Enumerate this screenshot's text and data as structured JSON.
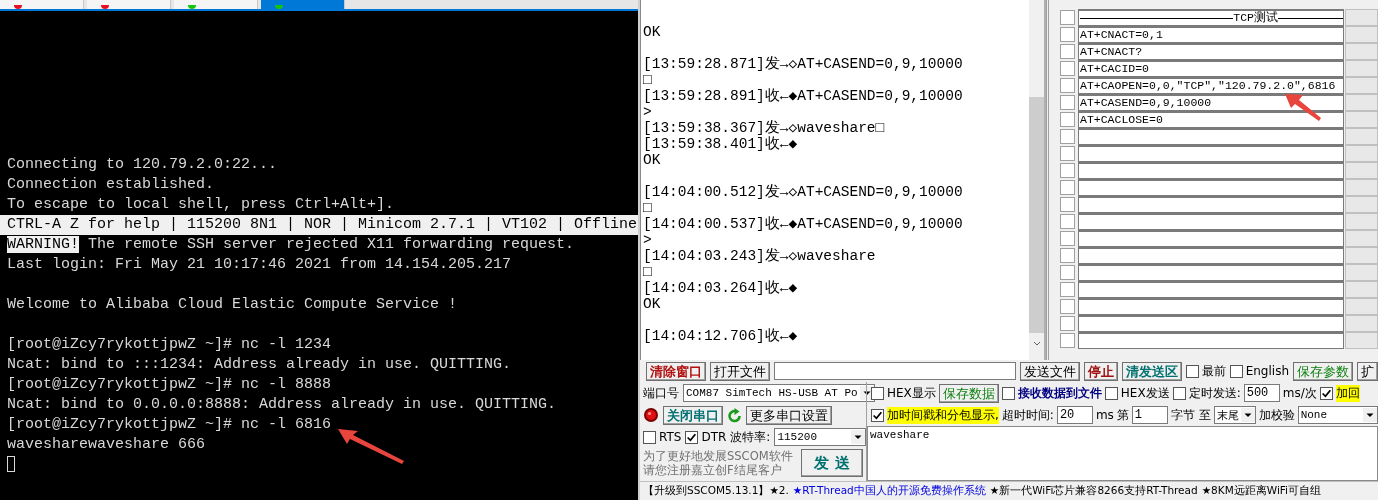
{
  "terminal": {
    "tabs": [
      {
        "color": "#e81123",
        "selected": false
      },
      {
        "color": "#e81123",
        "selected": false
      },
      {
        "color": "#16c60c",
        "selected": false
      },
      {
        "color": "#16c60c",
        "selected": true
      }
    ],
    "lines": [
      {
        "kind": "text",
        "segments": [
          {
            "text": "Connecting to 120.79.2.0:22...",
            "highlighted": false
          }
        ]
      },
      {
        "kind": "text",
        "segments": [
          {
            "text": "Connection established.",
            "highlighted": false
          }
        ]
      },
      {
        "kind": "text",
        "segments": [
          {
            "text": "To escape to local shell, press Ctrl+Alt+].",
            "highlighted": false
          }
        ]
      },
      {
        "kind": "bar",
        "text": "CTRL-A Z for help | 115200 8N1 | NOR | Minicom 2.7.1 | VT102 | Offline"
      },
      {
        "kind": "text",
        "segments": [
          {
            "text": "WARNING!",
            "highlighted": true
          },
          {
            "text": " The remote SSH server rejected X11 forwarding request.",
            "highlighted": false
          }
        ]
      },
      {
        "kind": "text",
        "segments": [
          {
            "text": "Last login: Fri May 21 10:17:46 2021 from 14.154.205.217",
            "highlighted": false
          }
        ]
      },
      {
        "kind": "blank"
      },
      {
        "kind": "text",
        "segments": [
          {
            "text": "Welcome to Alibaba Cloud Elastic Compute Service !",
            "highlighted": false
          }
        ]
      },
      {
        "kind": "blank"
      },
      {
        "kind": "text",
        "segments": [
          {
            "text": "[root@iZcy7rykottjpwZ ~]# nc -l 1234",
            "highlighted": false
          }
        ]
      },
      {
        "kind": "text",
        "segments": [
          {
            "text": "Ncat: bind to :::1234: Address already in use. QUITTING.",
            "highlighted": false
          }
        ]
      },
      {
        "kind": "text",
        "segments": [
          {
            "text": "[root@iZcy7rykottjpwZ ~]# nc -l 8888",
            "highlighted": false
          }
        ]
      },
      {
        "kind": "text",
        "segments": [
          {
            "text": "Ncat: bind to 0.0.0.0:8888: Address already in use. QUITTING.",
            "highlighted": false
          }
        ]
      },
      {
        "kind": "text",
        "segments": [
          {
            "text": "[root@iZcy7rykottjpwZ ~]# nc -l 6816",
            "highlighted": false
          }
        ]
      },
      {
        "kind": "text",
        "segments": [
          {
            "text": "wavesharewaveshare 666",
            "highlighted": false
          }
        ]
      },
      {
        "kind": "cursor"
      }
    ]
  },
  "log": {
    "lines": [
      {
        "kind": "text",
        "text": "OK"
      },
      {
        "kind": "gap"
      },
      {
        "kind": "text",
        "text": "[13:59:28.871]发→◇AT+CASEND=0,9,10000"
      },
      {
        "kind": "text",
        "text": "□"
      },
      {
        "kind": "text",
        "text": "[13:59:28.891]收←◆AT+CASEND=0,9,10000"
      },
      {
        "kind": "text",
        "text": ">"
      },
      {
        "kind": "text",
        "text": "[13:59:38.367]发→◇waveshare□"
      },
      {
        "kind": "text",
        "text": "[13:59:38.401]收←◆"
      },
      {
        "kind": "text",
        "text": "OK"
      },
      {
        "kind": "gap"
      },
      {
        "kind": "text",
        "text": "[14:04:00.512]发→◇AT+CASEND=0,9,10000"
      },
      {
        "kind": "text",
        "text": "□"
      },
      {
        "kind": "text",
        "text": "[14:04:00.537]收←◆AT+CASEND=0,9,10000"
      },
      {
        "kind": "text",
        "text": ">"
      },
      {
        "kind": "text",
        "text": "[14:04:03.243]发→◇waveshare"
      },
      {
        "kind": "text",
        "text": "□"
      },
      {
        "kind": "text",
        "text": "[14:04:03.264]收←◆"
      },
      {
        "kind": "text",
        "text": "OK"
      },
      {
        "kind": "gap"
      },
      {
        "kind": "text",
        "text": "[14:04:12.706]收←◆"
      }
    ]
  },
  "commands": [
    {
      "kind": "separator",
      "text": "TCP测试",
      "checked": false
    },
    {
      "kind": "command",
      "text": "AT+CNACT=0,1",
      "checked": false
    },
    {
      "kind": "command",
      "text": "AT+CNACT?",
      "checked": false
    },
    {
      "kind": "command",
      "text": "AT+CACID=0",
      "checked": false
    },
    {
      "kind": "command",
      "text": "AT+CAOPEN=0,0,\"TCP\",\"120.79.2.0\",6816",
      "checked": false
    },
    {
      "kind": "command",
      "text": "AT+CASEND=0,9,10000",
      "checked": false
    },
    {
      "kind": "command",
      "text": "AT+CACLOSE=0",
      "checked": false
    },
    {
      "kind": "empty",
      "checked": false
    },
    {
      "kind": "empty",
      "checked": false
    },
    {
      "kind": "empty",
      "checked": false
    },
    {
      "kind": "empty",
      "checked": false
    },
    {
      "kind": "empty",
      "checked": false
    },
    {
      "kind": "empty",
      "checked": false
    },
    {
      "kind": "empty",
      "checked": false
    },
    {
      "kind": "empty",
      "checked": false
    },
    {
      "kind": "empty",
      "checked": false
    },
    {
      "kind": "empty",
      "checked": false
    },
    {
      "kind": "empty",
      "checked": false
    },
    {
      "kind": "empty",
      "checked": false
    },
    {
      "kind": "empty",
      "checked": false
    }
  ],
  "toolbar": [
    {
      "kind": "button",
      "text": "清除窗口",
      "color": "#b01010",
      "bold": true
    },
    {
      "kind": "button",
      "text": "打开文件",
      "bold": false
    },
    {
      "kind": "field"
    },
    {
      "kind": "button",
      "text": "发送文件",
      "bold": false
    },
    {
      "kind": "button",
      "text": "停止",
      "color": "#a01010",
      "bold": true
    },
    {
      "kind": "button",
      "text": "清发送区",
      "color": "#007070",
      "bold": true
    },
    {
      "kind": "checkbox",
      "text": "最前",
      "checked": false,
      "highlighted": false
    },
    {
      "kind": "checkbox",
      "text": "English",
      "checked": false,
      "highlighted": false
    },
    {
      "kind": "button",
      "text": "保存参数",
      "color": "#108010",
      "bold": false
    },
    {
      "kind": "button",
      "text": "扩",
      "bold": false
    }
  ],
  "port_panel": [
    [
      {
        "kind": "label",
        "text": "端口号"
      },
      {
        "kind": "select",
        "text": "COM87 SimTech HS-USB AT Po"
      }
    ],
    [
      {
        "kind": "led"
      },
      {
        "kind": "button",
        "text": "关闭串口",
        "color": "#007070",
        "bold": true
      },
      {
        "kind": "refresh"
      },
      {
        "kind": "button",
        "text": "更多串口设置",
        "bold": false
      }
    ],
    [
      {
        "kind": "checkbox",
        "text": "RTS",
        "checked": false,
        "highlighted": false
      },
      {
        "kind": "checkbox",
        "text": "DTR",
        "checked": true,
        "highlighted": false
      },
      {
        "kind": "label",
        "text": "波特率:"
      },
      {
        "kind": "select",
        "text": "115200"
      }
    ],
    [
      {
        "kind": "note",
        "text": "为了更好地发展SSCOM软件"
      },
      {
        "kind": "note",
        "text": "请您注册嘉立创F结尾客户"
      },
      {
        "kind": "send",
        "text": "发  送"
      }
    ]
  ],
  "options": [
    [
      {
        "kind": "checkbox",
        "text": "HEX显示",
        "checked": false,
        "highlighted": false
      },
      {
        "kind": "button",
        "text": "保存数据",
        "color": "#108010",
        "bold": false
      },
      {
        "kind": "checkbox",
        "text": "接收数据到文件",
        "checked": false,
        "highlighted": false,
        "color": "#000080"
      },
      {
        "kind": "checkbox",
        "text": "HEX发送",
        "checked": false,
        "highlighted": false
      },
      {
        "kind": "checkbox",
        "text": "定时发送:",
        "checked": false,
        "highlighted": false
      },
      {
        "kind": "number",
        "text": "500"
      },
      {
        "kind": "label",
        "text": "ms/次"
      },
      {
        "kind": "checkbox",
        "text": "加回",
        "checked": true,
        "highlighted": true
      }
    ],
    [
      {
        "kind": "checkbox",
        "text": "加时间戳和分包显示,",
        "checked": true,
        "highlighted": true
      },
      {
        "kind": "label",
        "text": "超时时间:"
      },
      {
        "kind": "number",
        "text": "20"
      },
      {
        "kind": "label",
        "text": "ms"
      },
      {
        "kind": "label",
        "text": "第"
      },
      {
        "kind": "number",
        "text": "1"
      },
      {
        "kind": "label",
        "text": "字节 至"
      },
      {
        "kind": "select",
        "text": "末尾"
      },
      {
        "kind": "label",
        "text": "加校验"
      },
      {
        "kind": "select",
        "text": "None"
      }
    ]
  ],
  "send_box": {
    "value": "waveshare"
  },
  "status_bar": [
    {
      "kind": "plain",
      "text": "【升级到SSCOM5.13.1】★2."
    },
    {
      "kind": "link",
      "text": "★RT-Thread中国人的开源免费操作系统"
    },
    {
      "kind": "plain",
      "text": "★新一代WiFi芯片兼容8266支持RT-Thread"
    },
    {
      "kind": "plain",
      "text": "★8KM远距离WiFi可自组"
    }
  ]
}
